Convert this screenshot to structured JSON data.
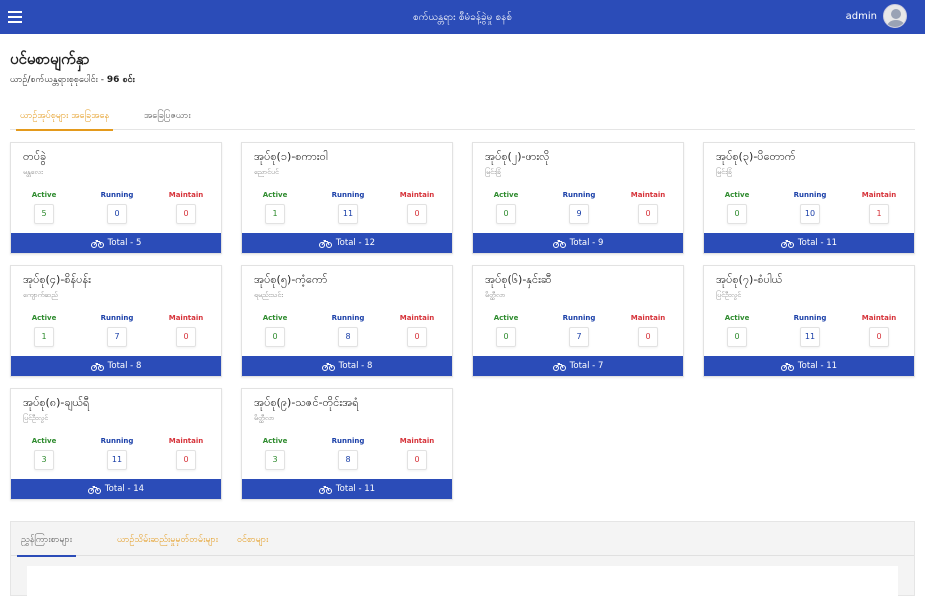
{
  "header": {
    "title": "စက်ယန္တရား စီမံခန့်ခွဲမှု စနစ်",
    "user": "admin"
  },
  "page": {
    "title": "ပင်မစာမျက်နှာ",
    "subtitle_label": "ယာဉ်/စက်ယန္တရားစုစုပေါင်း - ",
    "subtitle_count": "96 စင်း"
  },
  "tabs": [
    {
      "label": "ယာဉ်အုပ်စုများ အခြေအနေ"
    },
    {
      "label": "အခြေပြဇယား"
    }
  ],
  "stat_labels": {
    "active": "Active",
    "running": "Running",
    "maintain": "Maintain"
  },
  "cards": [
    {
      "title": "တပ်ခွဲ",
      "location": "မန္တလေး",
      "active": "5",
      "running": "0",
      "maintain": "0",
      "total": "Total - 5"
    },
    {
      "title": "အုပ်စု(၁)-စကားဝါ",
      "location": "ညောင်ပင်",
      "active": "1",
      "running": "11",
      "maintain": "0",
      "total": "Total - 12"
    },
    {
      "title": "အုပ်စု(၂)-ဖားလို",
      "location": "မြင်းခြံ",
      "active": "0",
      "running": "9",
      "maintain": "0",
      "total": "Total - 9"
    },
    {
      "title": "အုပ်စု(၃)-ပိတောက်",
      "location": "မြင်းခြံ",
      "active": "0",
      "running": "10",
      "maintain": "1",
      "total": "Total - 11"
    },
    {
      "title": "အုပ်စု(၄)-စိန်ပန်း",
      "location": "ကျောက်ဆည်",
      "active": "1",
      "running": "7",
      "maintain": "0",
      "total": "Total - 8"
    },
    {
      "title": "အုပ်စု(၅)-ကံ့ကော်",
      "location": "ရမည်းသင်း",
      "active": "0",
      "running": "8",
      "maintain": "0",
      "total": "Total - 8"
    },
    {
      "title": "အုပ်စု(၆)-နှင်းဆီ",
      "location": "မိတ္ထီလာ",
      "active": "0",
      "running": "7",
      "maintain": "0",
      "total": "Total - 7"
    },
    {
      "title": "အုပ်စု(၇)-စံပါယ်",
      "location": "ပြင်ဦးလွင်",
      "active": "0",
      "running": "11",
      "maintain": "0",
      "total": "Total - 11"
    },
    {
      "title": "အုပ်စု(၈)-ချယ်ရီ",
      "location": "ပြင်ဦးလွင်",
      "active": "3",
      "running": "11",
      "maintain": "0",
      "total": "Total - 14"
    },
    {
      "title": "အုပ်စု(၉)-သဇင်-တိုင်းအရံ",
      "location": "မိတ္ထီလာ",
      "active": "3",
      "running": "8",
      "maintain": "0",
      "total": "Total - 11"
    }
  ],
  "bottom_tabs": [
    {
      "label": "ညွှန်ကြားစာများ"
    },
    {
      "label": "ယာဉ်သိမ်းဆည်းမှုမှတ်တမ်းများ"
    },
    {
      "label": "ဝင်စာများ"
    }
  ],
  "colors": {
    "primary": "#2b4cb8",
    "accent": "#e49a1c",
    "active": "#2e8b2e",
    "running": "#1a3fa8",
    "maintain": "#d6333a"
  },
  "icons": {
    "menu": "hamburger-menu-icon",
    "avatar": "user-avatar-icon",
    "total": "motorbike-icon"
  }
}
